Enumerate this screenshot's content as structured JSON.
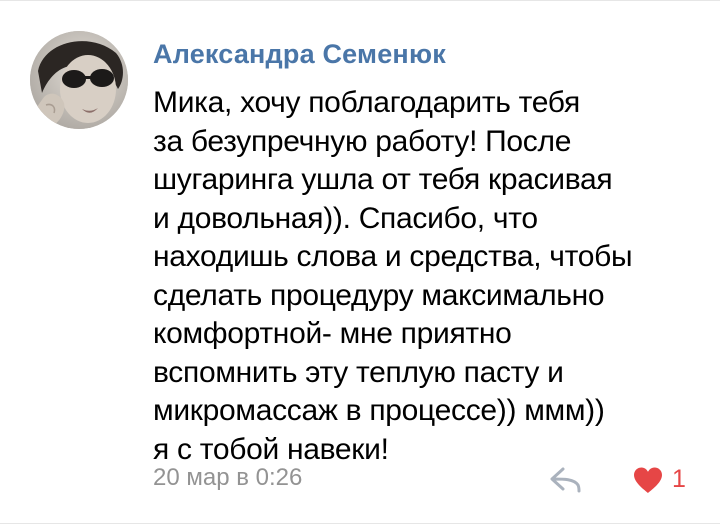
{
  "comment": {
    "author": "Александра Семенюк",
    "avatar_icon": "user-avatar-photo",
    "text_lines": [
      "Мика, хочу поблагодарить тебя",
      "за безупречную работу! После",
      "шугаринга ушла от тебя красивая",
      "и довольная)). Спасибо, что",
      "находишь слова и средства, чтобы",
      "сделать процедуру максимально",
      "комфортной- мне приятно",
      "вспомнить эту теплую пасту и",
      "микромассаж в процессе)) ммм))",
      "я с тобой навеки!"
    ],
    "date": "20 мар в 0:26",
    "reply_icon": "reply-arrow-icon",
    "like_icon": "heart-icon",
    "like_count": "1",
    "colors": {
      "author": "#4a76a8",
      "text": "#000000",
      "date": "#939393",
      "like": "#e64646",
      "reply_icon": "#aab2bd"
    }
  }
}
